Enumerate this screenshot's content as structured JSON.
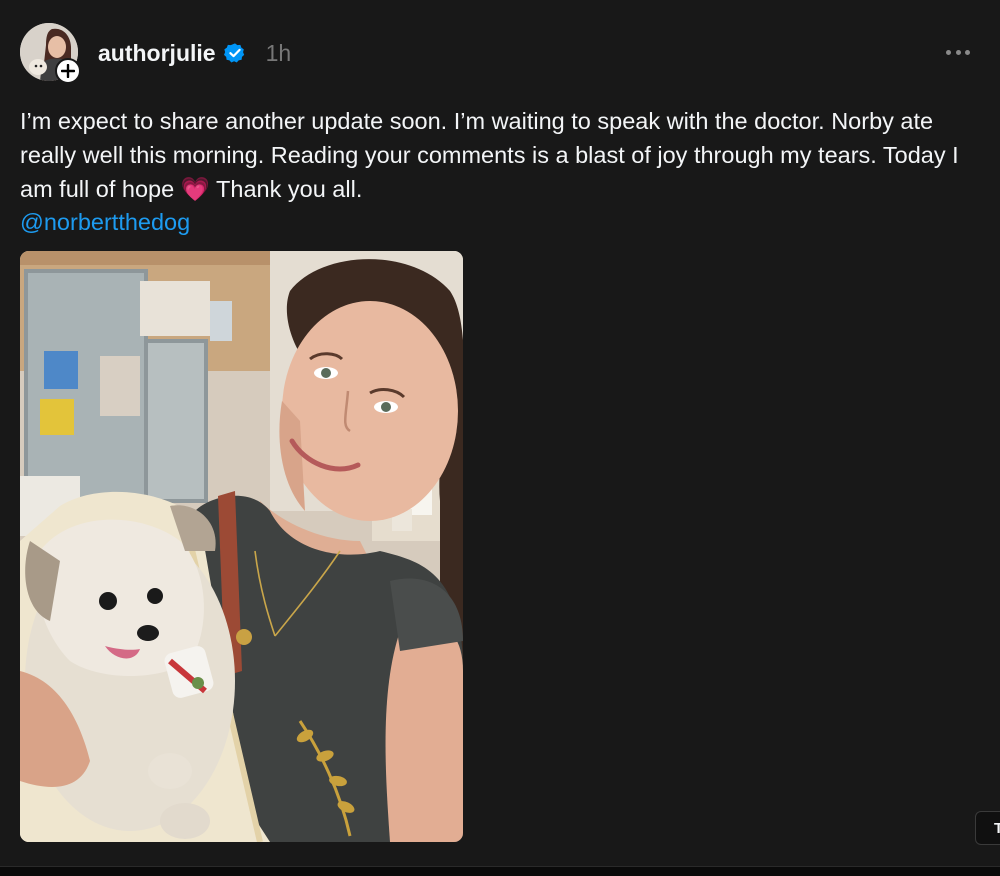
{
  "post": {
    "username": "authorjulie",
    "timestamp": "1h",
    "text": "I’m expect to share another update soon. I’m waiting to speak with the doctor. Norby ate really well this morning. Reading your comments is a blast of joy through my tears. Today I am full of hope 💗 Thank you all.",
    "mention": "@norbertthedog",
    "verified_icon": "verified-badge-icon",
    "more_icon": "more-options-icon"
  },
  "side_chip": {
    "label": "T"
  },
  "colors": {
    "background": "#181818",
    "text": "#f3f5f7",
    "muted": "#777777",
    "link": "#1d9bf0",
    "verified": "#0095f6"
  }
}
